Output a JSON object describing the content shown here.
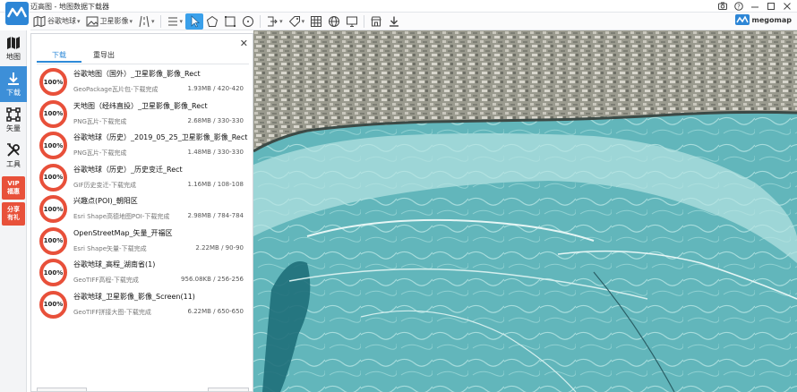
{
  "window": {
    "title": "迈高图 - 地图数据下载器",
    "controls": [
      "camera-icon",
      "help-icon",
      "minimize-icon",
      "maximize-icon",
      "close-icon"
    ]
  },
  "toolbar": {
    "map_source": "谷歌地球",
    "layer": "卫星影像",
    "brand": "megomap"
  },
  "sidebar": {
    "items": [
      {
        "label": "地图",
        "icon": "map-icon",
        "active": false
      },
      {
        "label": "下载",
        "icon": "download-icon",
        "active": true
      },
      {
        "label": "矢量",
        "icon": "vector-icon",
        "active": false
      },
      {
        "label": "工具",
        "icon": "tools-icon",
        "active": false
      }
    ],
    "promos": [
      {
        "line1": "VIP",
        "line2": "福惠"
      },
      {
        "line1": "分享",
        "line2": "有礼"
      }
    ]
  },
  "panel": {
    "tabs": [
      {
        "label": "下载",
        "active": true
      },
      {
        "label": "重导出",
        "active": false
      }
    ],
    "tasks": [
      {
        "progress": "100%",
        "name": "谷歌地图（国外）_卫星影像_影像_Rect",
        "status": "GeoPackage瓦片包-下载完成",
        "size": "1.93MB / 420-420"
      },
      {
        "progress": "100%",
        "name": "天地图（经纬直投）_卫星影像_影像_Rect",
        "status": "PNG瓦片-下载完成",
        "size": "2.68MB / 330-330"
      },
      {
        "progress": "100%",
        "name": "谷歌地球（历史）_2019_05_25_卫星影像_影像_Rect",
        "status": "PNG瓦片-下载完成",
        "size": "1.48MB / 330-330"
      },
      {
        "progress": "100%",
        "name": "谷歌地球（历史）_历史变迁_Rect",
        "status": "GIF历史变迁-下载完成",
        "size": "1.16MB / 108-108"
      },
      {
        "progress": "100%",
        "name": "兴趣点(POI)_朝阳区",
        "status": "Esri Shape高德地图POI-下载完成",
        "size": "2.98MB / 784-784"
      },
      {
        "progress": "100%",
        "name": "OpenStreetMap_矢量_开福区",
        "status": "Esri Shape矢量-下载完成",
        "size": "2.22MB / 90-90"
      },
      {
        "progress": "100%",
        "name": "谷歌地球_高程_湖南省(1)",
        "status": "GeoTIFF高程-下载完成",
        "size": "956.08KB / 256-256"
      },
      {
        "progress": "100%",
        "name": "谷歌地球_卫星影像_影像_Screen(11)",
        "status": "GeoTIFF拼接大图-下载完成",
        "size": "6.22MB / 650-650"
      }
    ]
  },
  "colors": {
    "accent": "#3d8fd8",
    "progress_ring": "#e8503a",
    "promo": "#e8513a"
  }
}
